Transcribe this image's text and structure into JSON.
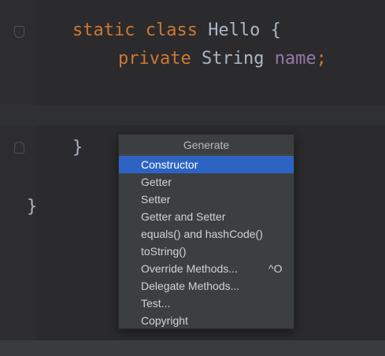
{
  "editor": {
    "lines": [
      {
        "keywords": "static class ",
        "name": "Hello",
        "brace": " {"
      },
      {
        "keyword": "private ",
        "type": "String ",
        "field": "name",
        "semi": ";"
      },
      {
        "brace": "}"
      },
      {
        "brace": "}"
      }
    ]
  },
  "popup": {
    "title": "Generate",
    "items": [
      {
        "label": "Constructor",
        "selected": true
      },
      {
        "label": "Getter"
      },
      {
        "label": "Setter"
      },
      {
        "label": "Getter and Setter"
      },
      {
        "label": "equals() and hashCode()"
      },
      {
        "label": "toString()"
      },
      {
        "label": "Override Methods...",
        "shortcut": "^O"
      },
      {
        "label": "Delegate Methods..."
      },
      {
        "label": "Test..."
      },
      {
        "label": "Copyright"
      }
    ]
  },
  "colors": {
    "background": "#2b2b2d",
    "keyword": "#cc7832",
    "field": "#9876aa",
    "selection": "#2d64c4",
    "popup_bg": "#3c3f41"
  }
}
